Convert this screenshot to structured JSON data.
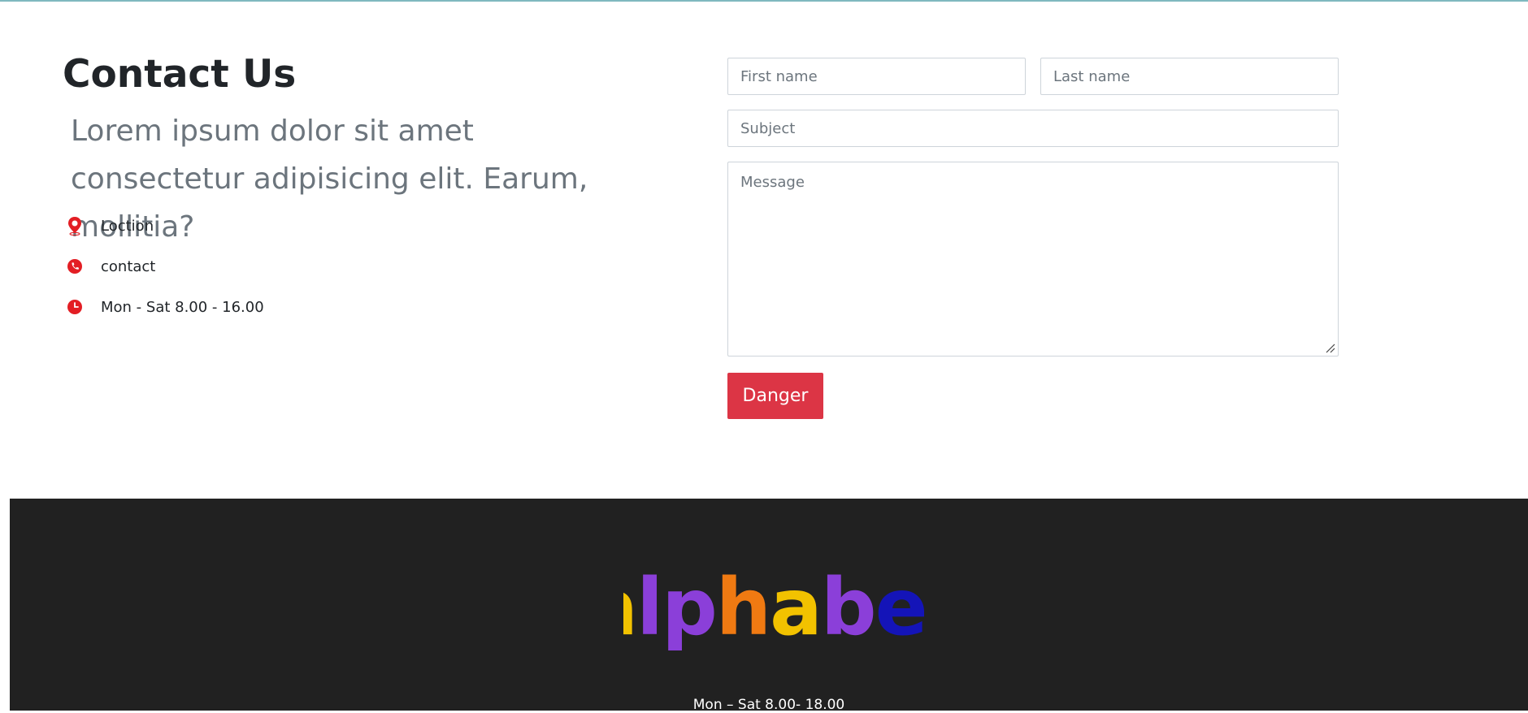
{
  "contact": {
    "title": "Contact Us",
    "lead": "Lorem ipsum dolor sit amet consectetur adipisicing elit. Earum, mollitia?",
    "info": {
      "location": "Loction",
      "contact": "contact",
      "hours": "Mon - Sat 8.00 - 16.00"
    },
    "icons": [
      "location-pin-icon",
      "phone-icon",
      "clock-icon"
    ]
  },
  "form": {
    "first_name_placeholder": "First name",
    "last_name_placeholder": "Last name",
    "subject_placeholder": "Subject",
    "message_placeholder": "Message",
    "submit_label": "Danger"
  },
  "footer": {
    "logo_text": "alphabet",
    "hours": "Mon – Sat 8.00- 18.00"
  },
  "colors": {
    "accent": "#dc3545",
    "icon_red": "#e31e24",
    "footer_bg": "#212121",
    "logo": [
      "#f2c200",
      "#8b3fd9",
      "#8b3fd9",
      "#f07a12",
      "#f2c200",
      "#8b3fd9",
      "#1414b8",
      "#16a6d9"
    ]
  }
}
